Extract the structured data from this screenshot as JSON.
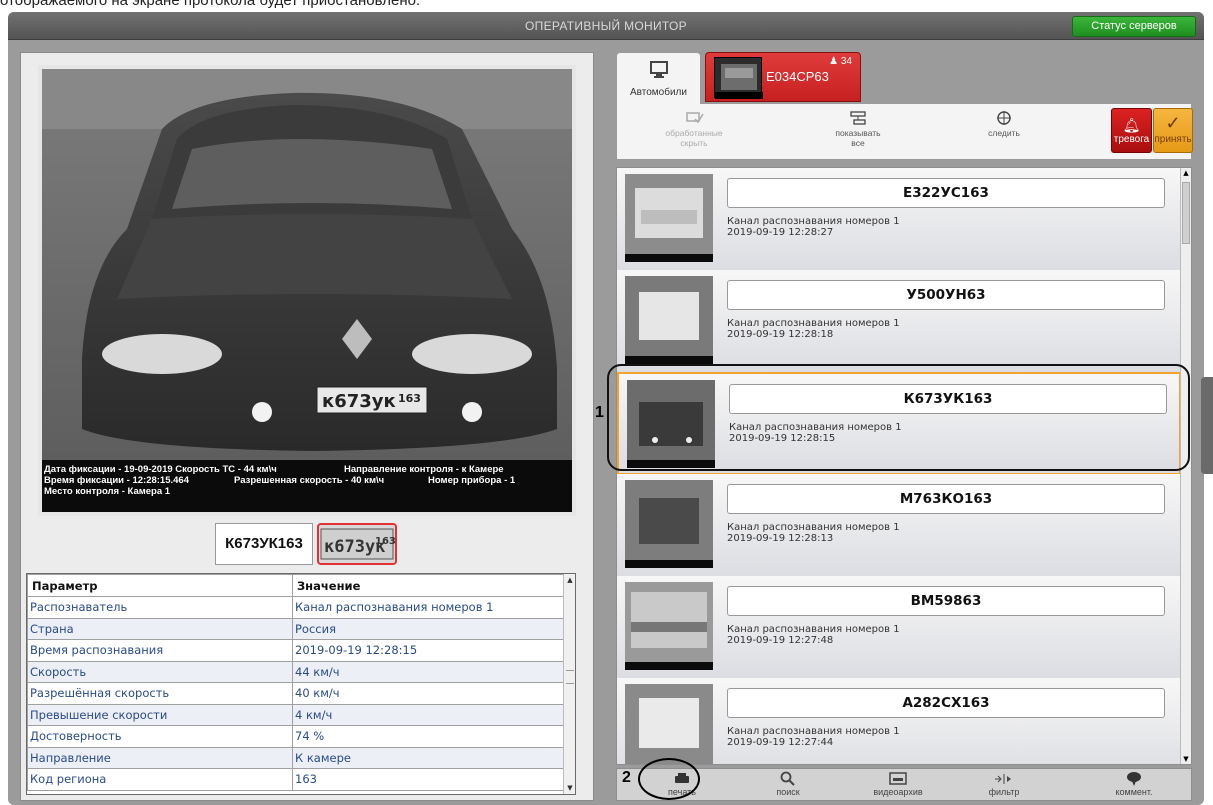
{
  "caption": "отображаемого на экране протокола будет приостановлено.",
  "window": {
    "title": "ОПЕРАТИВНЫЙ МОНИТОР",
    "status_button": "Статус серверов"
  },
  "video": {
    "overlay_line1_a": "Дата фиксации - 19-09-2019 Скорость ТС - 44 км\\ч",
    "overlay_line1_b": "Направление контроля - к Камере",
    "overlay_line2_a": "Время фиксации - 12:28:15.464",
    "overlay_line2_b": "Разрешенная скорость - 40 км\\ч",
    "overlay_line2_c": "Номер прибора - 1",
    "overlay_line3": "Место контроля - Камера 1",
    "car_plate_text": "к673ук",
    "car_plate_region": "163"
  },
  "recognized": {
    "plate_text": "К673УК163",
    "plate_img_main": "к673ук",
    "plate_img_region": "163"
  },
  "params": {
    "col_param": "Параметр",
    "col_value": "Значение",
    "rows": [
      {
        "name": "Распознаватель",
        "value": "Канал распознавания номеров 1"
      },
      {
        "name": "Страна",
        "value": "Россия"
      },
      {
        "name": "Время распознавания",
        "value": "2019-09-19 12:28:15"
      },
      {
        "name": "Скорость",
        "value": "44 км/ч"
      },
      {
        "name": "Разрешённая скорость",
        "value": "40 км/ч"
      },
      {
        "name": "Превышение скорости",
        "value": "4 км/ч"
      },
      {
        "name": "Достоверность",
        "value": "74 %"
      },
      {
        "name": "Направление",
        "value": "К камере"
      },
      {
        "name": "Код региона",
        "value": "163"
      }
    ]
  },
  "tabs": {
    "cars_label": "Автомобили",
    "alert_plate": "Е034СР63",
    "alert_count": "34"
  },
  "toolbar": {
    "processed_l1": "обработанные",
    "processed_l2": "скрыть",
    "showall_l1": "показывать",
    "showall_l2": "все",
    "follow": "следить",
    "alarm": "тревога",
    "accept": "принять"
  },
  "events": [
    {
      "plate": "Е322УС163",
      "channel": "Канал распознавания номеров 1",
      "time": "2019-09-19 12:28:27"
    },
    {
      "plate": "У500УН63",
      "channel": "Канал распознавания номеров 1",
      "time": "2019-09-19 12:28:18"
    },
    {
      "plate": "К673УК163",
      "channel": "Канал распознавания номеров 1",
      "time": "2019-09-19 12:28:15"
    },
    {
      "plate": "М763КО163",
      "channel": "Канал распознавания номеров 1",
      "time": "2019-09-19 12:28:13"
    },
    {
      "plate": "ВМ59863",
      "channel": "Канал распознавания номеров 1",
      "time": "2019-09-19 12:27:48"
    },
    {
      "plate": "А282СХ163",
      "channel": "Канал распознавания номеров 1",
      "time": "2019-09-19 12:27:44"
    }
  ],
  "bottom": {
    "print": "печать",
    "search": "поиск",
    "archive": "видеоархив",
    "filter": "фильтр",
    "comment": "коммент."
  },
  "annotations": {
    "label1": "1",
    "label2": "2"
  }
}
